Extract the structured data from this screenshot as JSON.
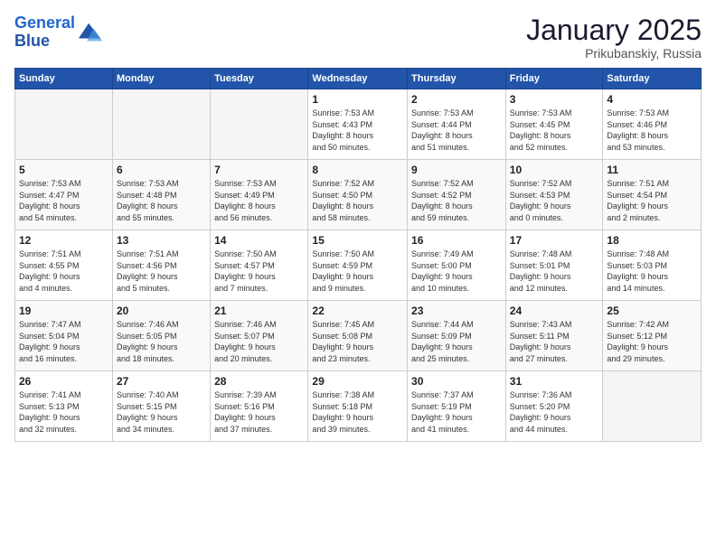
{
  "header": {
    "logo_line1": "General",
    "logo_line2": "Blue",
    "month_title": "January 2025",
    "location": "Prikubanskiy, Russia"
  },
  "weekdays": [
    "Sunday",
    "Monday",
    "Tuesday",
    "Wednesday",
    "Thursday",
    "Friday",
    "Saturday"
  ],
  "weeks": [
    [
      {
        "day": "",
        "info": ""
      },
      {
        "day": "",
        "info": ""
      },
      {
        "day": "",
        "info": ""
      },
      {
        "day": "1",
        "info": "Sunrise: 7:53 AM\nSunset: 4:43 PM\nDaylight: 8 hours\nand 50 minutes."
      },
      {
        "day": "2",
        "info": "Sunrise: 7:53 AM\nSunset: 4:44 PM\nDaylight: 8 hours\nand 51 minutes."
      },
      {
        "day": "3",
        "info": "Sunrise: 7:53 AM\nSunset: 4:45 PM\nDaylight: 8 hours\nand 52 minutes."
      },
      {
        "day": "4",
        "info": "Sunrise: 7:53 AM\nSunset: 4:46 PM\nDaylight: 8 hours\nand 53 minutes."
      }
    ],
    [
      {
        "day": "5",
        "info": "Sunrise: 7:53 AM\nSunset: 4:47 PM\nDaylight: 8 hours\nand 54 minutes."
      },
      {
        "day": "6",
        "info": "Sunrise: 7:53 AM\nSunset: 4:48 PM\nDaylight: 8 hours\nand 55 minutes."
      },
      {
        "day": "7",
        "info": "Sunrise: 7:53 AM\nSunset: 4:49 PM\nDaylight: 8 hours\nand 56 minutes."
      },
      {
        "day": "8",
        "info": "Sunrise: 7:52 AM\nSunset: 4:50 PM\nDaylight: 8 hours\nand 58 minutes."
      },
      {
        "day": "9",
        "info": "Sunrise: 7:52 AM\nSunset: 4:52 PM\nDaylight: 8 hours\nand 59 minutes."
      },
      {
        "day": "10",
        "info": "Sunrise: 7:52 AM\nSunset: 4:53 PM\nDaylight: 9 hours\nand 0 minutes."
      },
      {
        "day": "11",
        "info": "Sunrise: 7:51 AM\nSunset: 4:54 PM\nDaylight: 9 hours\nand 2 minutes."
      }
    ],
    [
      {
        "day": "12",
        "info": "Sunrise: 7:51 AM\nSunset: 4:55 PM\nDaylight: 9 hours\nand 4 minutes."
      },
      {
        "day": "13",
        "info": "Sunrise: 7:51 AM\nSunset: 4:56 PM\nDaylight: 9 hours\nand 5 minutes."
      },
      {
        "day": "14",
        "info": "Sunrise: 7:50 AM\nSunset: 4:57 PM\nDaylight: 9 hours\nand 7 minutes."
      },
      {
        "day": "15",
        "info": "Sunrise: 7:50 AM\nSunset: 4:59 PM\nDaylight: 9 hours\nand 9 minutes."
      },
      {
        "day": "16",
        "info": "Sunrise: 7:49 AM\nSunset: 5:00 PM\nDaylight: 9 hours\nand 10 minutes."
      },
      {
        "day": "17",
        "info": "Sunrise: 7:48 AM\nSunset: 5:01 PM\nDaylight: 9 hours\nand 12 minutes."
      },
      {
        "day": "18",
        "info": "Sunrise: 7:48 AM\nSunset: 5:03 PM\nDaylight: 9 hours\nand 14 minutes."
      }
    ],
    [
      {
        "day": "19",
        "info": "Sunrise: 7:47 AM\nSunset: 5:04 PM\nDaylight: 9 hours\nand 16 minutes."
      },
      {
        "day": "20",
        "info": "Sunrise: 7:46 AM\nSunset: 5:05 PM\nDaylight: 9 hours\nand 18 minutes."
      },
      {
        "day": "21",
        "info": "Sunrise: 7:46 AM\nSunset: 5:07 PM\nDaylight: 9 hours\nand 20 minutes."
      },
      {
        "day": "22",
        "info": "Sunrise: 7:45 AM\nSunset: 5:08 PM\nDaylight: 9 hours\nand 23 minutes."
      },
      {
        "day": "23",
        "info": "Sunrise: 7:44 AM\nSunset: 5:09 PM\nDaylight: 9 hours\nand 25 minutes."
      },
      {
        "day": "24",
        "info": "Sunrise: 7:43 AM\nSunset: 5:11 PM\nDaylight: 9 hours\nand 27 minutes."
      },
      {
        "day": "25",
        "info": "Sunrise: 7:42 AM\nSunset: 5:12 PM\nDaylight: 9 hours\nand 29 minutes."
      }
    ],
    [
      {
        "day": "26",
        "info": "Sunrise: 7:41 AM\nSunset: 5:13 PM\nDaylight: 9 hours\nand 32 minutes."
      },
      {
        "day": "27",
        "info": "Sunrise: 7:40 AM\nSunset: 5:15 PM\nDaylight: 9 hours\nand 34 minutes."
      },
      {
        "day": "28",
        "info": "Sunrise: 7:39 AM\nSunset: 5:16 PM\nDaylight: 9 hours\nand 37 minutes."
      },
      {
        "day": "29",
        "info": "Sunrise: 7:38 AM\nSunset: 5:18 PM\nDaylight: 9 hours\nand 39 minutes."
      },
      {
        "day": "30",
        "info": "Sunrise: 7:37 AM\nSunset: 5:19 PM\nDaylight: 9 hours\nand 41 minutes."
      },
      {
        "day": "31",
        "info": "Sunrise: 7:36 AM\nSunset: 5:20 PM\nDaylight: 9 hours\nand 44 minutes."
      },
      {
        "day": "",
        "info": ""
      }
    ]
  ]
}
